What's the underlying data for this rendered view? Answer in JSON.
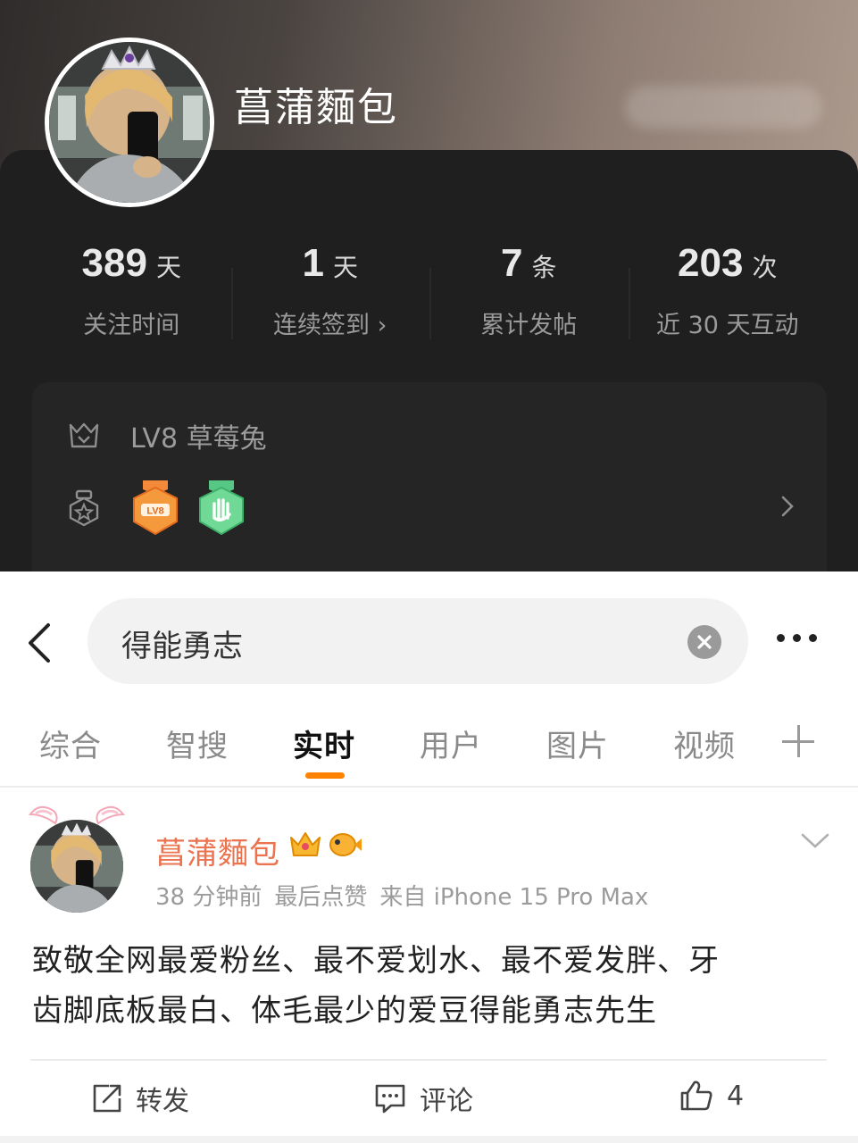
{
  "profile": {
    "name": "菖蒲麵包",
    "stats": [
      {
        "num": "389",
        "unit": "天",
        "label": "关注时间"
      },
      {
        "num": "1",
        "unit": "天",
        "label": "连续签到 ›"
      },
      {
        "num": "7",
        "unit": "条",
        "label": "累计发帖"
      },
      {
        "num": "203",
        "unit": "次",
        "label": "近 30 天互动"
      }
    ],
    "level": "LV8 草莓兔"
  },
  "search": {
    "query": "得能勇志"
  },
  "tabs": [
    {
      "label": "综合"
    },
    {
      "label": "智搜"
    },
    {
      "label": "实时"
    },
    {
      "label": "用户"
    },
    {
      "label": "图片"
    },
    {
      "label": "视频"
    }
  ],
  "post": {
    "author": "菖蒲麵包",
    "time": "38 分钟前",
    "status": "最后点赞",
    "source": "来自 iPhone 15 Pro Max",
    "text_line1": "致敬全网最爱粉丝、最不爱划水、最不爱发胖、牙",
    "text_line2": "齿脚底板最白、体毛最少的爱豆得能勇志先生",
    "actions": {
      "repost": "转发",
      "comment": "评论",
      "like_count": "4"
    }
  },
  "colors": {
    "accent": "#ff8200",
    "author_name": "#eb7350",
    "dark_card": "#1f1f1f"
  }
}
